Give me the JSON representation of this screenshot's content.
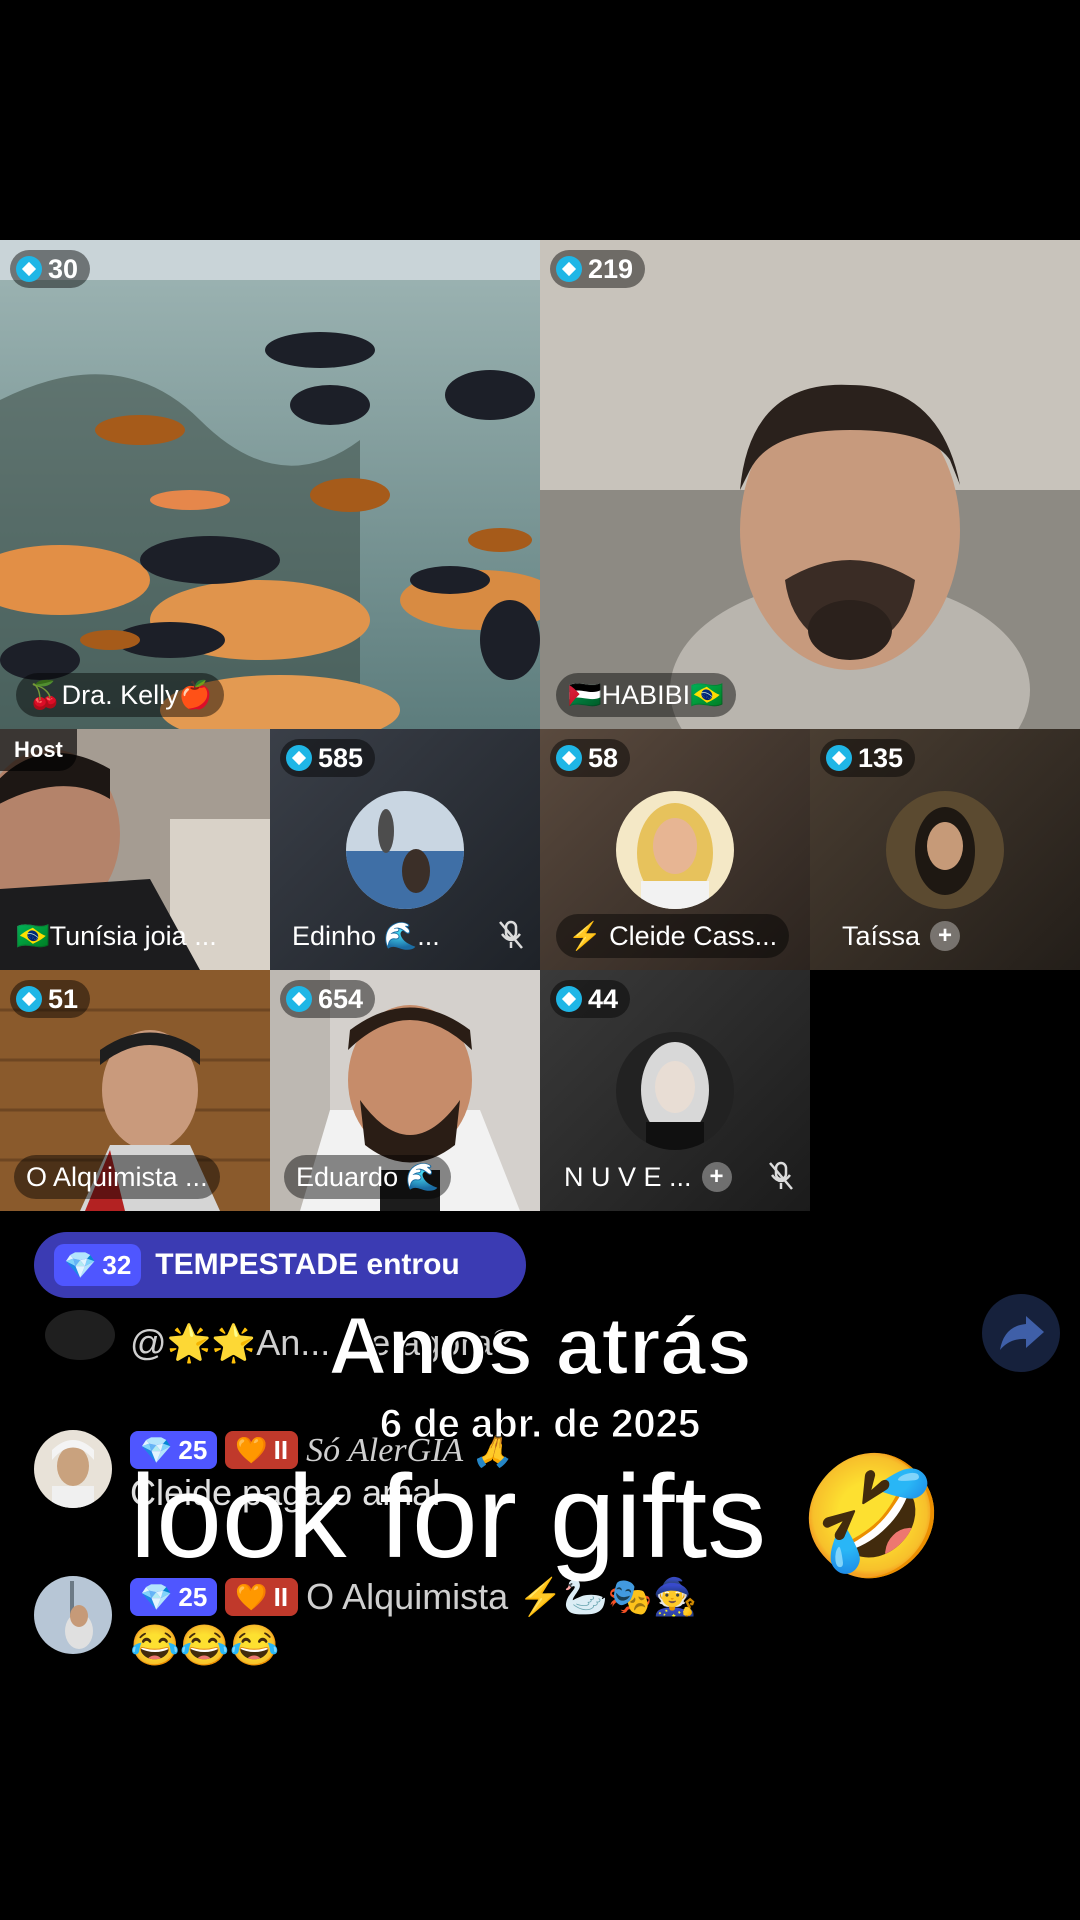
{
  "tiles": [
    {
      "viewers": "30",
      "name": "🍒Dra. Kelly🍎"
    },
    {
      "viewers": "219",
      "name": "🇵🇸HABIBI🇧🇷"
    },
    {
      "host_label": "Host",
      "name": "🇧🇷Tunísia joia ..."
    },
    {
      "viewers": "585",
      "name": "Edinho 🌊..."
    },
    {
      "viewers": "58",
      "name": "⚡ Cleide Cass..."
    },
    {
      "viewers": "135",
      "name": "Taíssa"
    },
    {
      "viewers": "51",
      "name": "O Alquimista ..."
    },
    {
      "viewers": "654",
      "name": "Eduardo 🌊"
    },
    {
      "viewers": "44",
      "name": "N U V E ..."
    }
  ],
  "join_banner": {
    "level": "32",
    "text": "TEMPESTADE entrou"
  },
  "chat": [
    {
      "text": "@🌟🌟An... ...e agora?"
    },
    {
      "level": "25",
      "fan_level": "II",
      "username": "Só AlerGIA 🙏",
      "message": "Cleide paga o amal"
    },
    {
      "level": "25",
      "fan_level": "II",
      "username": "O Alquimista ⚡🦢🎭🧙",
      "message": "😂😂😂"
    }
  ],
  "overlay": {
    "title": "Anos atrás",
    "date": "6 de abr. de 2025",
    "caption": "look for gifts 🤣"
  }
}
